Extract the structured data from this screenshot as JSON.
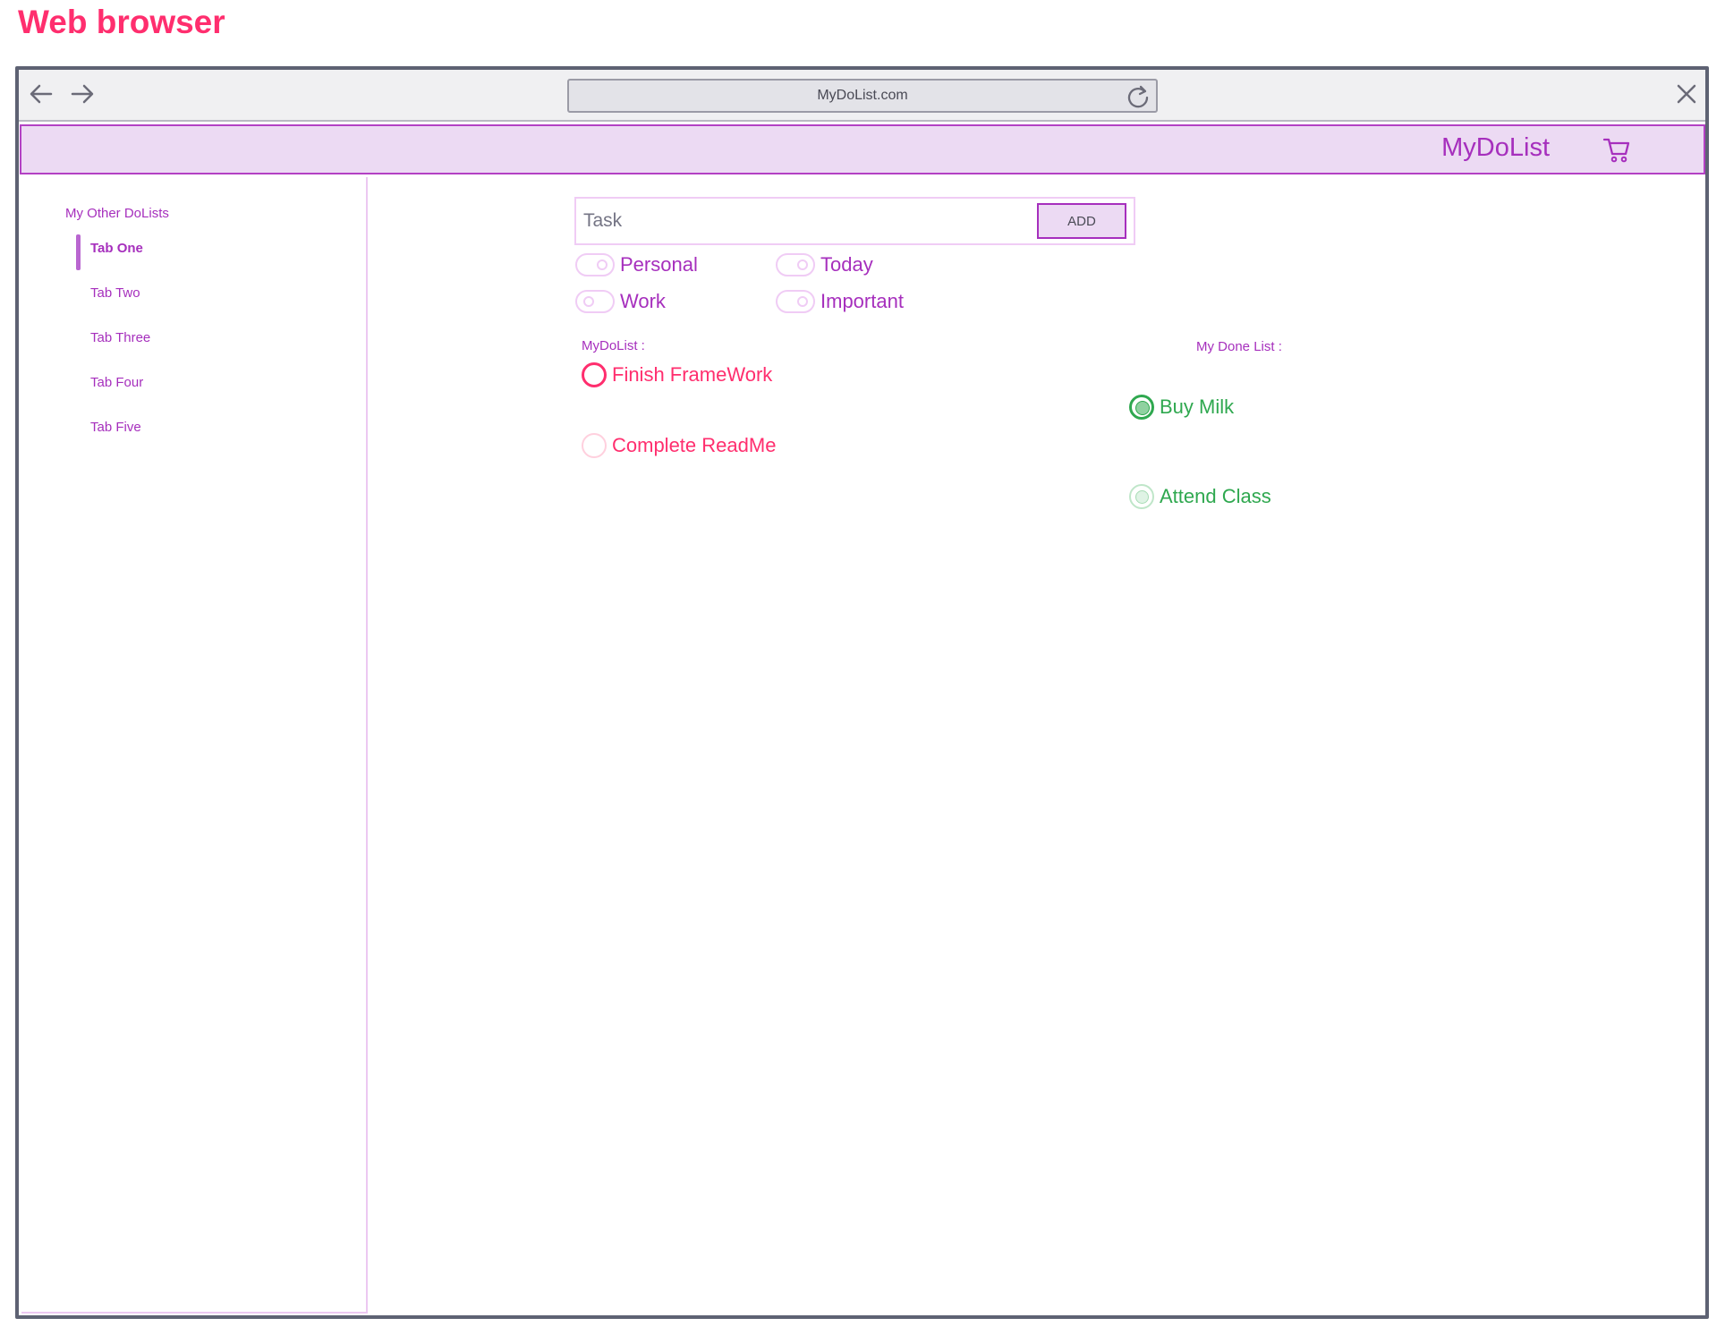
{
  "page": {
    "title": "Web browser"
  },
  "browser": {
    "url": "MyDoList.com",
    "icons": {
      "back": "arrow-left-icon",
      "forward": "arrow-right-icon",
      "reload": "reload-icon",
      "close": "close-icon"
    }
  },
  "header": {
    "brand": "MyDoList",
    "cart_icon": "cart-icon",
    "background": "#ecdaf3",
    "border": "#b341c4"
  },
  "sidebar": {
    "title": "My Other DoLists",
    "items": [
      {
        "label": "Tab One",
        "active": true
      },
      {
        "label": "Tab Two",
        "active": false
      },
      {
        "label": "Tab Three",
        "active": false
      },
      {
        "label": "Tab Four",
        "active": false
      },
      {
        "label": "Tab Five",
        "active": false
      }
    ]
  },
  "task_form": {
    "placeholder": "Task",
    "value": "",
    "add_label": "ADD"
  },
  "toggles": [
    {
      "label": "Personal",
      "on": true
    },
    {
      "label": "Today",
      "on": true
    },
    {
      "label": "Work",
      "on": false
    },
    {
      "label": "Important",
      "on": true
    }
  ],
  "todo_list": {
    "heading": "MyDoList :",
    "items": [
      {
        "label": "Finish FrameWork",
        "checked": false
      },
      {
        "label": "Complete ReadMe",
        "checked": false
      }
    ]
  },
  "done_list": {
    "heading": "My Done List :",
    "items": [
      {
        "label": "Buy Milk",
        "checked": true
      },
      {
        "label": "Attend Class",
        "checked": true
      }
    ]
  },
  "colors": {
    "accent": "#a62fbd",
    "todo": "#ff2e6e",
    "done": "#2fa84f",
    "title": "#ff2e6e"
  }
}
